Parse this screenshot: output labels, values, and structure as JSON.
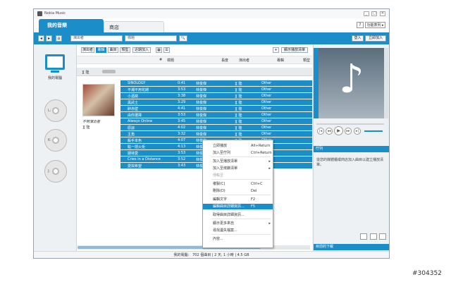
{
  "window": {
    "title": "Nokia Music",
    "min": "_",
    "max": "□",
    "close": "✕"
  },
  "tabs": {
    "main": "我的音樂",
    "shop": "商店"
  },
  "header": {
    "help": "?",
    "bar_label": "功能表列 ▸"
  },
  "toolbar": {
    "back": "◂",
    "forward": "▸",
    "home": "⌂",
    "artist_value": "演出者",
    "title_value": "標題",
    "search_icon": "🔍",
    "login": "登入",
    "join": "立即加入"
  },
  "left_panel": {
    "my_computer": "我的電腦",
    "drives": [
      "L:",
      "K:",
      "J:"
    ]
  },
  "view_buttons": [
    "演出者",
    "專輯",
    "曲目",
    "類型",
    "近期加入"
  ],
  "view_toggles": [
    "▦",
    "☰"
  ],
  "add_button": "+",
  "show_playlist": "顯示播放清單",
  "columns": {
    "num": "#",
    "title": "標題",
    "length": "長度",
    "artist": "演出者",
    "album": "專輯",
    "genre": "類型"
  },
  "group_label": "][ 陸",
  "album_info": {
    "title": "不明演出者",
    "artist": "][ 陸"
  },
  "tracks": [
    {
      "title": "SINOLOGY",
      "length": "0:41",
      "artist": "林俊傑",
      "album": "][ 陸",
      "genre": "Other"
    },
    {
      "title": "不潮不用花錢",
      "length": "3:53",
      "artist": "林俊傑",
      "album": "][ 陸",
      "genre": "Other"
    },
    {
      "title": "小酒窩",
      "length": "3:38",
      "artist": "林俊傑",
      "album": "][ 陸",
      "genre": "Other"
    },
    {
      "title": "黑武士",
      "length": "3:29",
      "artist": "林俊傑",
      "album": "][ 陸",
      "genre": "Other"
    },
    {
      "title": "醉赤壁",
      "length": "4:41",
      "artist": "林俊傑",
      "album": "][ 陸",
      "genre": "Other"
    },
    {
      "title": "由你選擇",
      "length": "3:53",
      "artist": "林俊傑",
      "album": "][ 陸",
      "genre": "Other"
    },
    {
      "title": "Always Online",
      "length": "3:45",
      "artist": "林俊傑",
      "album": "][ 陸",
      "genre": "Other"
    },
    {
      "title": "原諒",
      "length": "4:02",
      "artist": "林俊傑",
      "album": "][ 陸",
      "genre": "Other"
    },
    {
      "title": "主角",
      "length": "3:32",
      "artist": "林俊傑",
      "album": "][ 陸",
      "genre": "Other"
    },
    {
      "title": "殺手本色",
      "length": "4:07",
      "artist": "林俊傑",
      "album": "][ 陸",
      "genre": "Other"
    },
    {
      "title": "點一把火炬",
      "length": "4:13",
      "artist": "林俊傑",
      "album": "][ 陸",
      "genre": "Other"
    },
    {
      "title": "期待愛",
      "length": "3:53",
      "artist": "林俊傑",
      "album": "][ 陸",
      "genre": "Other"
    },
    {
      "title": "Cries in a Distance",
      "length": "3:52",
      "artist": "林俊傑",
      "album": "][ 陸",
      "genre": "Other"
    },
    {
      "title": "愛與希望",
      "length": "3:43",
      "artist": "林俊傑",
      "album": "][ 陸",
      "genre": "Other"
    }
  ],
  "context_menu": [
    {
      "label": "立即播放",
      "shortcut": "Alt+Return"
    },
    {
      "label": "加入至佇列",
      "shortcut": "Ctrl+Return"
    },
    {
      "label": "加入至播放清單",
      "arrow": "▸"
    },
    {
      "label": "加入至燒錄清單",
      "arrow": "▸"
    },
    {
      "label": "傳輸至",
      "disabled": true
    },
    {
      "label": "複製(C)",
      "shortcut": "Ctrl+C"
    },
    {
      "label": "刪除(D)",
      "shortcut": "Del"
    },
    {
      "label": "編輯文字",
      "shortcut": "F2"
    },
    {
      "label": "編輯曲目詳細資訊...",
      "shortcut": "F5",
      "highlighted": true
    },
    {
      "label": "取得曲目詳細資訊..."
    },
    {
      "label": "顯示更多來自",
      "arrow": "▸"
    },
    {
      "label": "尋找遺失檔案..."
    },
    {
      "label": "內容..."
    }
  ],
  "player": {
    "prev": "|◂",
    "rw": "◂◂",
    "play": "▶",
    "fwd": "▸▸",
    "next": "▸|"
  },
  "queue": {
    "header": "佇列",
    "text": "從您的媒體櫃或商店加入曲目以建立播放清單。"
  },
  "downloads": {
    "header": "目前的下載"
  },
  "status": {
    "text": "我的電腦： 702 個曲目  |  2 天, 1 小時  |  4.5 GB"
  },
  "stamp": "#304352",
  "colors": {
    "accent": "#1b8ec9",
    "selected_row": "#1b8ec9"
  }
}
